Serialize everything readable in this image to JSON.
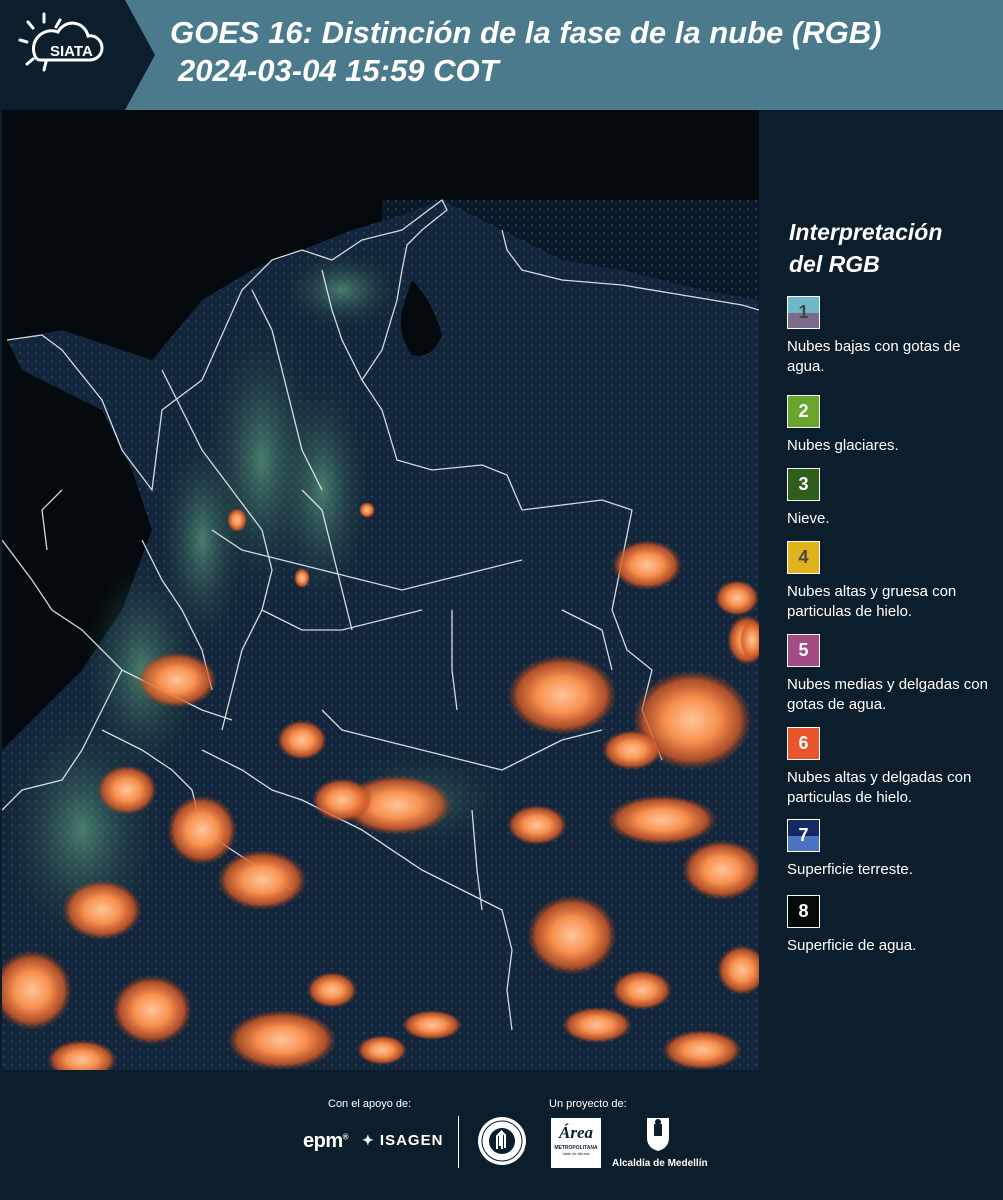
{
  "header": {
    "logo_text": "SIATA",
    "title_line1": "GOES 16: Distinción de la fase de la nube (RGB)",
    "title_line2": "2024-03-04 15:59 COT"
  },
  "legend": {
    "title_line1": "Interpretación",
    "title_line2": "del RGB",
    "items": [
      {
        "num": "1",
        "top_color": "#6fb8c8",
        "bottom_color": "#7b6a8a",
        "label": "Nubes bajas con gotas de agua.",
        "num_color": "#444444"
      },
      {
        "num": "2",
        "top_color": "#6aa52e",
        "bottom_color": "#6aa52e",
        "label": "Nubes glaciares.",
        "num_color": "#ffffff"
      },
      {
        "num": "3",
        "top_color": "#2f5e1c",
        "bottom_color": "#2f5e1c",
        "label": "Nieve.",
        "num_color": "#ffffff"
      },
      {
        "num": "4",
        "top_color": "#e0b31c",
        "bottom_color": "#e0b31c",
        "label": "Nubes altas y gruesa con particulas de hielo.",
        "num_color": "#444444"
      },
      {
        "num": "5",
        "top_color": "#a24b84",
        "bottom_color": "#a24b84",
        "label": "Nubes medias y delgadas con gotas de agua.",
        "num_color": "#ffffff"
      },
      {
        "num": "6",
        "top_color": "#e8552a",
        "bottom_color": "#e8552a",
        "label": "Nubes altas y delgadas con particulas de hielo.",
        "num_color": "#ffffff"
      },
      {
        "num": "7",
        "top_color": "#142a66",
        "bottom_color": "#4a74c2",
        "label": "Superficie terreste.",
        "num_color": "#ffffff"
      },
      {
        "num": "8",
        "top_color": "#040a08",
        "bottom_color": "#040a08",
        "label": "Superficie de agua.",
        "num_color": "#ffffff"
      }
    ]
  },
  "footer": {
    "support_label": "Con el apoyo de:",
    "project_label": "Un proyecto de:",
    "epm_text": "epm",
    "isagen_text": "ISAGEN",
    "area_caption": "METROPOLITANA",
    "area_caption2": "Valle de Aburrá",
    "area_word": "Área",
    "medellin_caption": "Alcaldía de Medellín"
  }
}
